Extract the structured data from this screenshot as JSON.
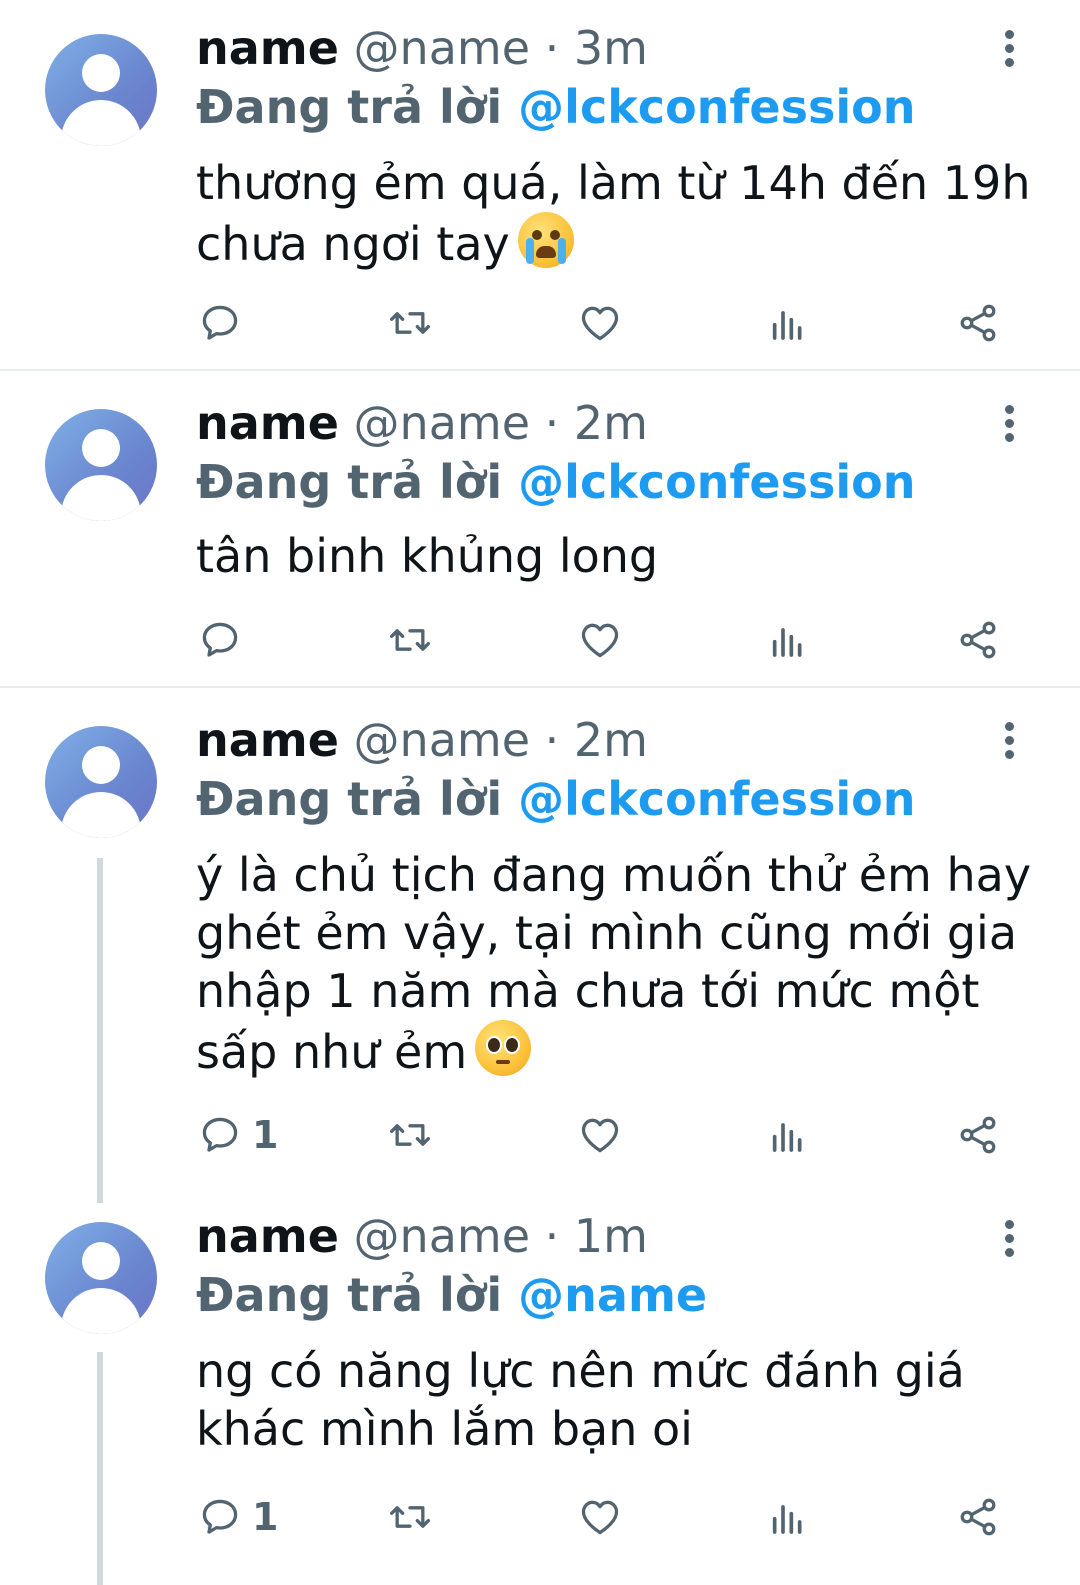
{
  "colors": {
    "accent": "#1d9bf0",
    "secondary_text": "#536471",
    "divider": "#e6ecf0",
    "thread_line": "#cfd9de"
  },
  "tweets": [
    {
      "name": "name",
      "meta": "@name · 3m",
      "reply_lead": "Đang trả lời",
      "reply_to": "@lckconfession",
      "text": "thương ẻm quá, làm từ 14h đến 19h chưa ngơi tay",
      "emoji": "loudly-crying-face",
      "reply_count": ""
    },
    {
      "name": "name",
      "meta": "@name · 2m",
      "reply_lead": "Đang trả lời",
      "reply_to": "@lckconfession",
      "text": "tân binh khủng long",
      "emoji": "",
      "reply_count": ""
    },
    {
      "name": "name",
      "meta": "@name · 2m",
      "reply_lead": "Đang trả lời",
      "reply_to": "@lckconfession",
      "text": "ý là chủ tịch đang muốn thử ẻm hay ghét ẻm vậy, tại mình cũng mới gia nhập 1 năm mà chưa tới mức một sấp như ẻm",
      "emoji": "pleading-face",
      "reply_count": "1"
    },
    {
      "name": "name",
      "meta": "@name · 1m",
      "reply_lead": "Đang trả lời",
      "reply_to": "@name",
      "text": "ng có năng lực nên mức đánh giá khác mình lắm bạn oi",
      "emoji": "",
      "reply_count": "1"
    }
  ],
  "action_icons": [
    "reply-icon",
    "retweet-icon",
    "like-icon",
    "views-icon",
    "share-icon"
  ]
}
